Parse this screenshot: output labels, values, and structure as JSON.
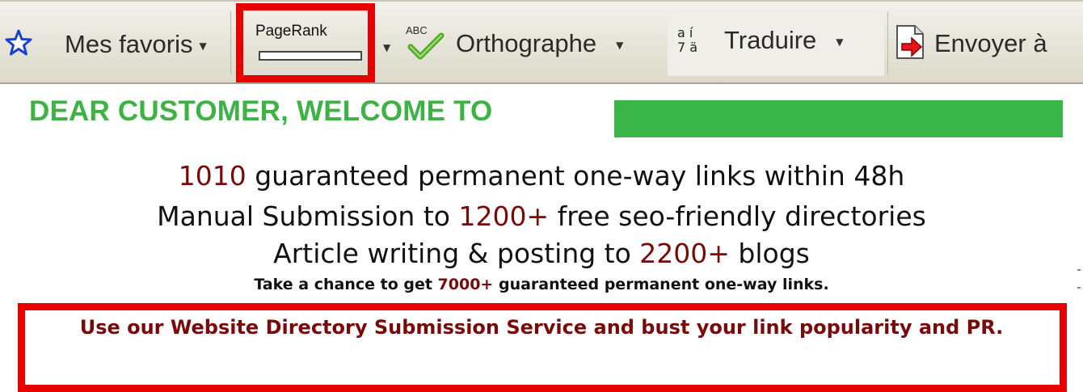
{
  "toolbar": {
    "favorites_label": "Mes favoris",
    "pagerank_label": "PageRank",
    "pagerank_fill": 0.0,
    "spelling_badge": "ABC",
    "spelling_label": "Orthographe",
    "translate_glyphs_top": "a í",
    "translate_glyphs_bottom": "7 ä",
    "translate_label": "Traduire",
    "send_label": "Envoyer à"
  },
  "page": {
    "welcome": "DEAR CUSTOMER, WELCOME TO",
    "line1": {
      "num": "1010",
      "text": " guaranteed permanent one-way links within 48h"
    },
    "line2": {
      "pre": "Manual Submission to ",
      "num": "1200+",
      "post": " free seo-friendly directories"
    },
    "line3": {
      "pre": "Article writing & posting to ",
      "num": "2200+",
      "post": " blogs"
    },
    "line4": {
      "pre": "Take a chance to get ",
      "num": "7000+",
      "post": " guaranteed permanent one-way links."
    },
    "cta": "Use our Website Directory Submission Service and bust your link popularity and PR."
  },
  "colors": {
    "highlight": "#e80000",
    "welcome_green": "#3cb343",
    "number_red": "#7a0a0a"
  }
}
